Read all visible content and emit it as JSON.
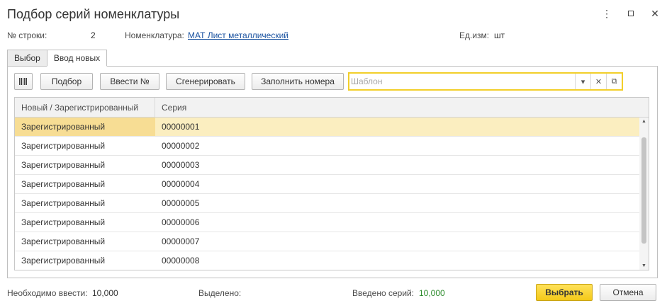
{
  "window": {
    "title": "Подбор серий номенклатуры",
    "menu_icon": "kebab-menu-icon",
    "maximize_icon": "maximize-icon",
    "close_icon": "close-icon"
  },
  "info": {
    "row_label": "№ строки:",
    "row_value": "2",
    "nomenclature_label": "Номенклатура:",
    "nomenclature_value": "МАТ Лист металлический",
    "unit_label": "Ед.изм:",
    "unit_value": "шт"
  },
  "tabs": [
    {
      "label": "Выбор",
      "active": false
    },
    {
      "label": "Ввод новых",
      "active": true
    }
  ],
  "toolbar": {
    "barcode_icon": "barcode-icon",
    "pick_label": "Подбор",
    "enter_numbers_label": "Ввести №",
    "generate_label": "Сгенерировать",
    "fill_numbers_label": "Заполнить номера",
    "template_placeholder": "Шаблон",
    "template_value": "",
    "accent_color": "#f2cf2a"
  },
  "table": {
    "columns": [
      "Новый / Зарегистрированный",
      "Серия"
    ],
    "rows": [
      {
        "status": "Зарегистрированный",
        "series": "00000001",
        "selected": true
      },
      {
        "status": "Зарегистрированный",
        "series": "00000002"
      },
      {
        "status": "Зарегистрированный",
        "series": "00000003"
      },
      {
        "status": "Зарегистрированный",
        "series": "00000004"
      },
      {
        "status": "Зарегистрированный",
        "series": "00000005"
      },
      {
        "status": "Зарегистрированный",
        "series": "00000006"
      },
      {
        "status": "Зарегистрированный",
        "series": "00000007"
      },
      {
        "status": "Зарегистрированный",
        "series": "00000008"
      }
    ],
    "selected_color": "#fbeec0"
  },
  "status": {
    "need_label": "Необходимо ввести:",
    "need_value": "10,000",
    "selected_label": "Выделено:",
    "entered_label": "Введено серий:",
    "entered_value": "10,000",
    "entered_color": "#2a8a2a"
  },
  "footer": {
    "select_label": "Выбрать",
    "cancel_label": "Отмена",
    "primary_color": "#f4c918"
  }
}
